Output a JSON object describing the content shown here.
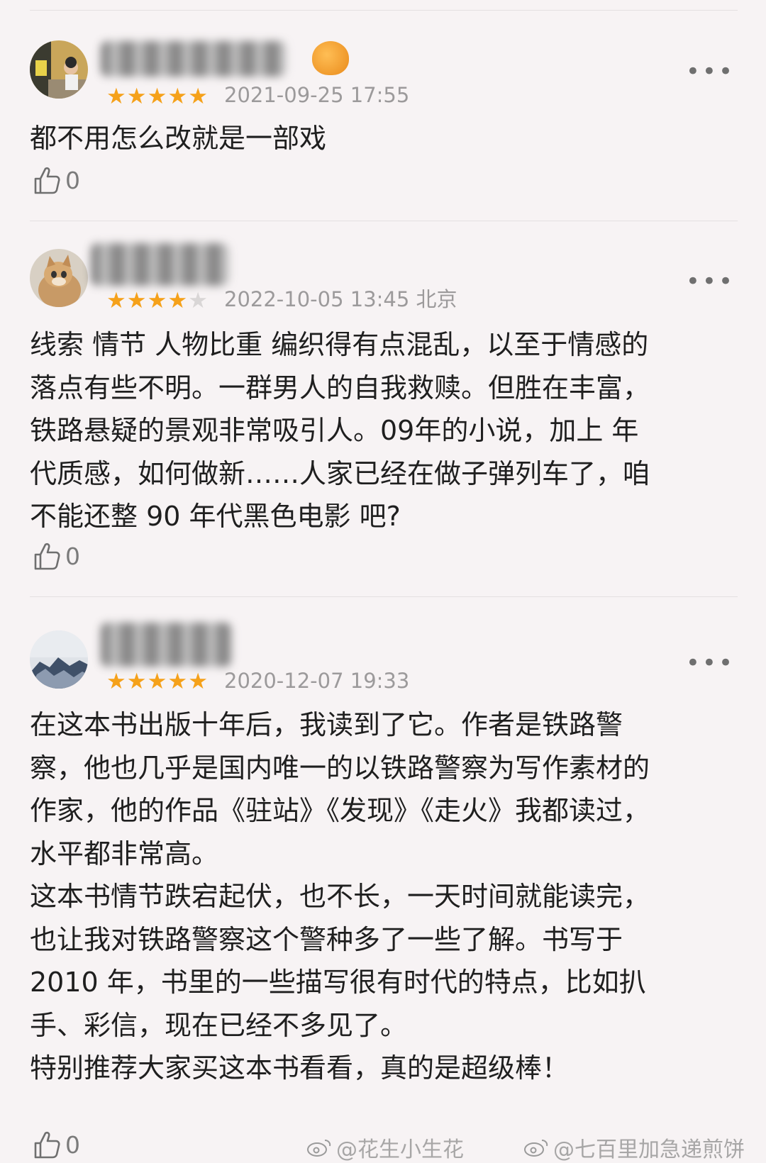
{
  "reviews": [
    {
      "stars": 5,
      "date": "2021-09-25 17:55",
      "location": "",
      "content": "都不用怎么改就是一部戏",
      "likes": "0"
    },
    {
      "stars": 4,
      "date": "2022-10-05 13:45",
      "location": "北京",
      "content": "线索 情节 人物比重 编织得有点混乱，以至于情感的\n落点有些不明。一群男人的自我救赎。但胜在丰富，\n铁路悬疑的景观非常吸引人。09年的小说，加上 年\n代质感，如何做新……人家已经在做子弹列车了，咱\n不能还整 90 年代黑色电影 吧?",
      "likes": "0"
    },
    {
      "stars": 5,
      "date": "2020-12-07 19:33",
      "location": "",
      "content": "在这本书出版十年后，我读到了它。作者是铁路警\n察，他也几乎是国内唯一的以铁路警察为写作素材的\n作家，他的作品《驻站》《发现》《走火》我都读过，\n水平都非常高。\n这本书情节跌宕起伏，也不长，一天时间就能读完，\n也让我对铁路警察这个警种多了一些了解。书写于\n2010 年，书里的一些描写很有时代的特点，比如扒\n手、彩信，现在已经不多见了。\n特别推荐大家买这本书看看，真的是超级棒！",
      "likes": "0"
    }
  ],
  "watermarks": [
    "@花生小生花",
    "@七百里加急递煎饼"
  ],
  "colors": {
    "star": "#f5a11a",
    "meta": "#9c9a9b",
    "background": "#f7f3f4"
  }
}
